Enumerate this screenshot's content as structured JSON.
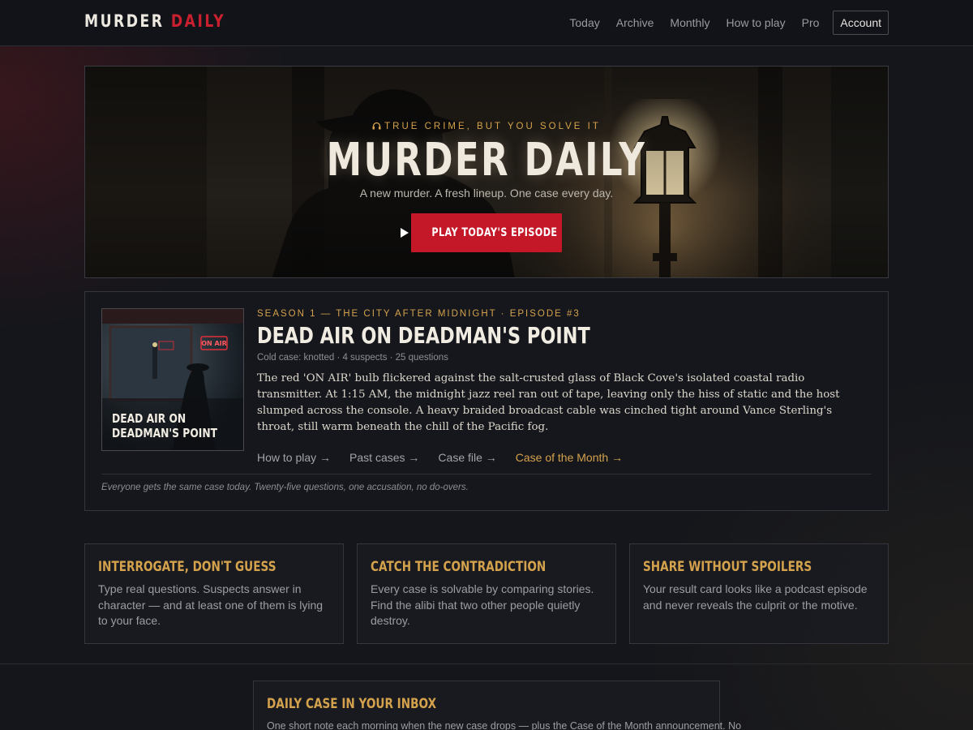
{
  "nav": {
    "logo_main": "MURDER",
    "logo_accent": "DAILY",
    "links": [
      "Today",
      "Archive",
      "Monthly",
      "How to play",
      "Pro"
    ],
    "account": "Account"
  },
  "hero": {
    "kicker": "TRUE CRIME, BUT YOU SOLVE IT",
    "title": "MURDER DAILY",
    "subtitle": "A new murder. A fresh lineup. One case every day.",
    "play_button": "PLAY TODAY'S EPISODE"
  },
  "episode": {
    "thumb_title": "DEAD AIR ON DEADMAN'S POINT",
    "kicker": "SEASON 1 — THE CITY AFTER MIDNIGHT · EPISODE #3",
    "title": "DEAD AIR ON DEADMAN'S POINT",
    "meta": "Cold case: knotted · 4 suspects · 25 questions",
    "story": "The red 'ON AIR' bulb flickered against the salt-crusted glass of Black Cove's isolated coastal radio transmitter. At 1:15 AM, the midnight jazz reel ran out of tape, leaving only the hiss of static and the host slumped across the console. A heavy braided broadcast cable was cinched tight around Vance Sterling's throat, still warm beneath the chill of the Pacific fog.",
    "links": [
      "How to play →",
      "Past cases →",
      "Case file →"
    ],
    "highlight_link": "Case of the Month →",
    "note": "Everyone gets the same case today. Twenty-five questions, one accusation, no do-overs."
  },
  "features": [
    {
      "title": "INTERROGATE, DON'T GUESS",
      "text": "Type real questions. Suspects answer in character — and at least one of them is lying to your face."
    },
    {
      "title": "CATCH THE CONTRADICTION",
      "text": "Every case is solvable by comparing stories. Find the alibi that two other people quietly destroy."
    },
    {
      "title": "SHARE WITHOUT SPOILERS",
      "text": "Your result card looks like a podcast episode and never reveals the culprit or the motive."
    }
  ],
  "newsletter": {
    "title": "DAILY CASE IN YOUR INBOX",
    "text": "One short note each morning when the new case drops — plus the Case of the Month announcement. No"
  },
  "colors": {
    "accent_red": "#c41828",
    "accent_gold": "#d4a24c",
    "background": "#14161b"
  },
  "icons": {
    "kicker": "headphones-icon",
    "play": "play-icon",
    "thumb_sign": "on-air-sign"
  }
}
